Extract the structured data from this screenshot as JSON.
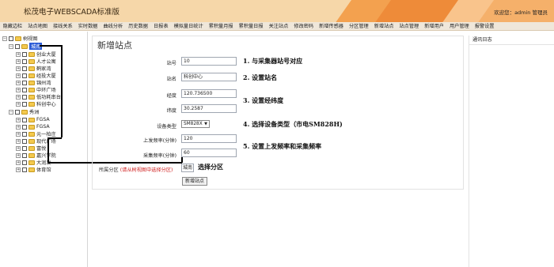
{
  "header": {
    "title": "松茂电子WEBSCADA标准版",
    "welcome": "欢迎您：admin 管理员"
  },
  "nav": [
    "隐藏边栏",
    "站点地图",
    "接线关系",
    "实时数据",
    "曲线分析",
    "历史数据",
    "日报表",
    "模拟量日统计",
    "累积量月报",
    "累积量日报",
    "关注站点",
    "修改密码",
    "新增传感器",
    "分区管理",
    "新增站点",
    "站点管理",
    "新增用户",
    "用户管理",
    "报警设置"
  ],
  "tree": {
    "root": "树视图",
    "groups": [
      {
        "name": "城南",
        "selected": true,
        "items": [
          "创业大厦",
          "人才公寓",
          "鹤家湾",
          "经投大厦",
          "锦州湾",
          "中环广场",
          "低功耗串台",
          "科创中心"
        ]
      },
      {
        "name": "秀洲",
        "selected": false,
        "items": [
          "FGSA",
          "FGSA",
          "元一柏庄",
          "现代广场",
          "富悦",
          "嘉兴学院",
          "大润发",
          "体育馆"
        ]
      }
    ]
  },
  "form": {
    "title": "新增站点",
    "station_id_label": "站号",
    "station_id_value": "10",
    "station_name_label": "站名",
    "station_name_value": "科创中心",
    "longitude_label": "经度",
    "longitude_value": "120.736500",
    "latitude_label": "纬度",
    "latitude_value": "30.2587",
    "device_type_label": "设备类型",
    "device_type_value": "SM828X",
    "upload_freq_label": "上发频率(分钟)",
    "upload_freq_value": "120",
    "sample_freq_label": "采集频率(分钟)",
    "sample_freq_value": "60",
    "zone_label": "所属分区",
    "zone_hint": "(请从树视图中选择分区)",
    "zone_value": "城南",
    "zone_note": "选择分区",
    "submit_label": "新增站点"
  },
  "notes": [
    "1. 与采集器站号对应",
    "2. 设置站名",
    "3. 设置经纬度",
    "4. 选择设备类型（市电SM828H)",
    "5. 设置上发频率和采集频率"
  ],
  "right_panel": {
    "title": "通讯日志"
  }
}
